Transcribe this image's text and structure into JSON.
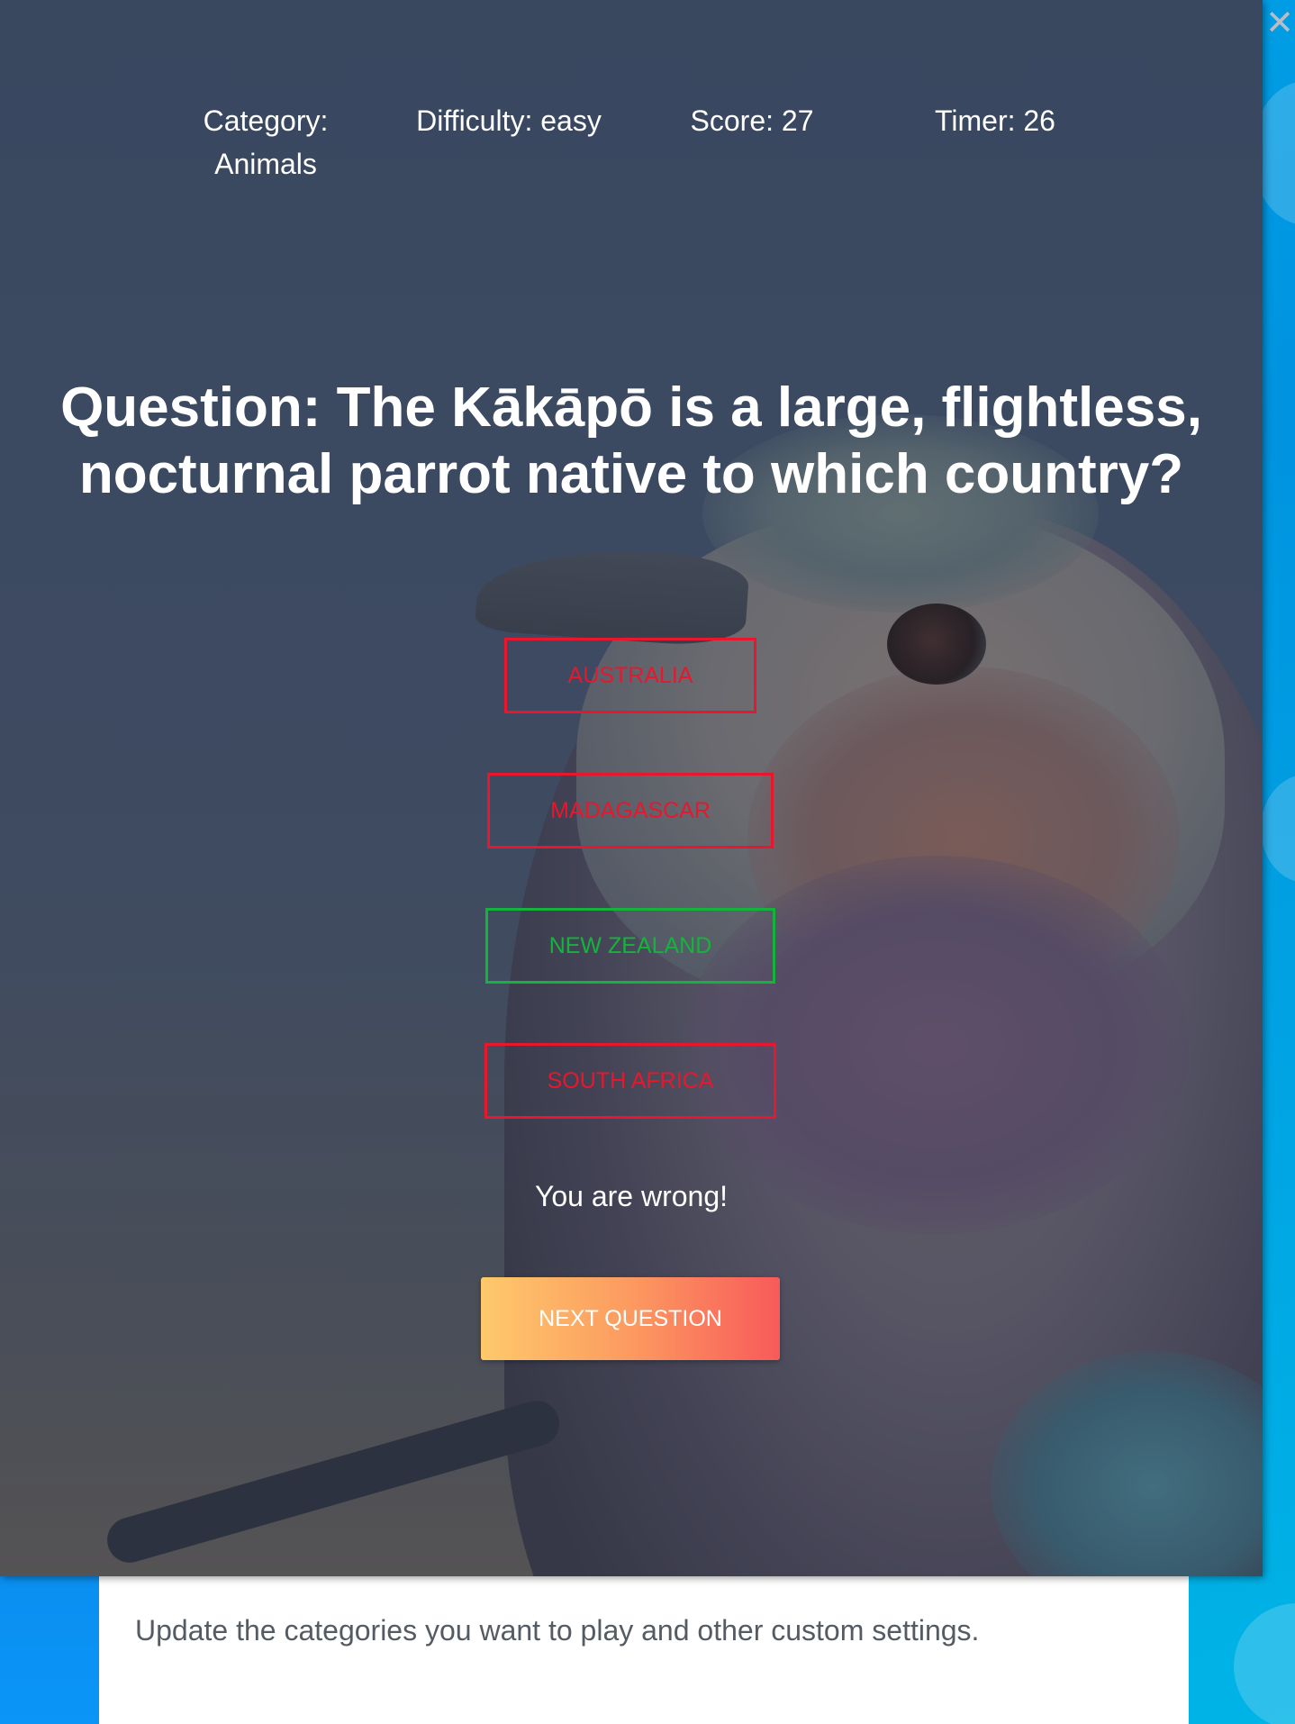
{
  "stats": {
    "category": "Category:\nAnimals",
    "difficulty": "Difficulty: easy",
    "score": "Score: 27",
    "timer": "Timer: 26"
  },
  "question": "Question: The Kākāpō is a large, flightless, nocturnal parrot native to which country?",
  "answers": [
    {
      "label": "AUSTRALIA",
      "state": "wrong"
    },
    {
      "label": "MADAGASCAR",
      "state": "wrong"
    },
    {
      "label": "NEW ZEALAND",
      "state": "correct"
    },
    {
      "label": "SOUTH AFRICA",
      "state": "wrong"
    }
  ],
  "feedback": "You are wrong!",
  "next_button": "NEXT QUESTION",
  "background_panel": {
    "description": "Update the categories you want to play and other custom settings."
  },
  "colors": {
    "wrong": "#e8172d",
    "correct": "#14b43c",
    "button_gradient_start": "#fec96b",
    "button_gradient_end": "#f85a5a"
  },
  "icons": {
    "close": "close-icon"
  }
}
